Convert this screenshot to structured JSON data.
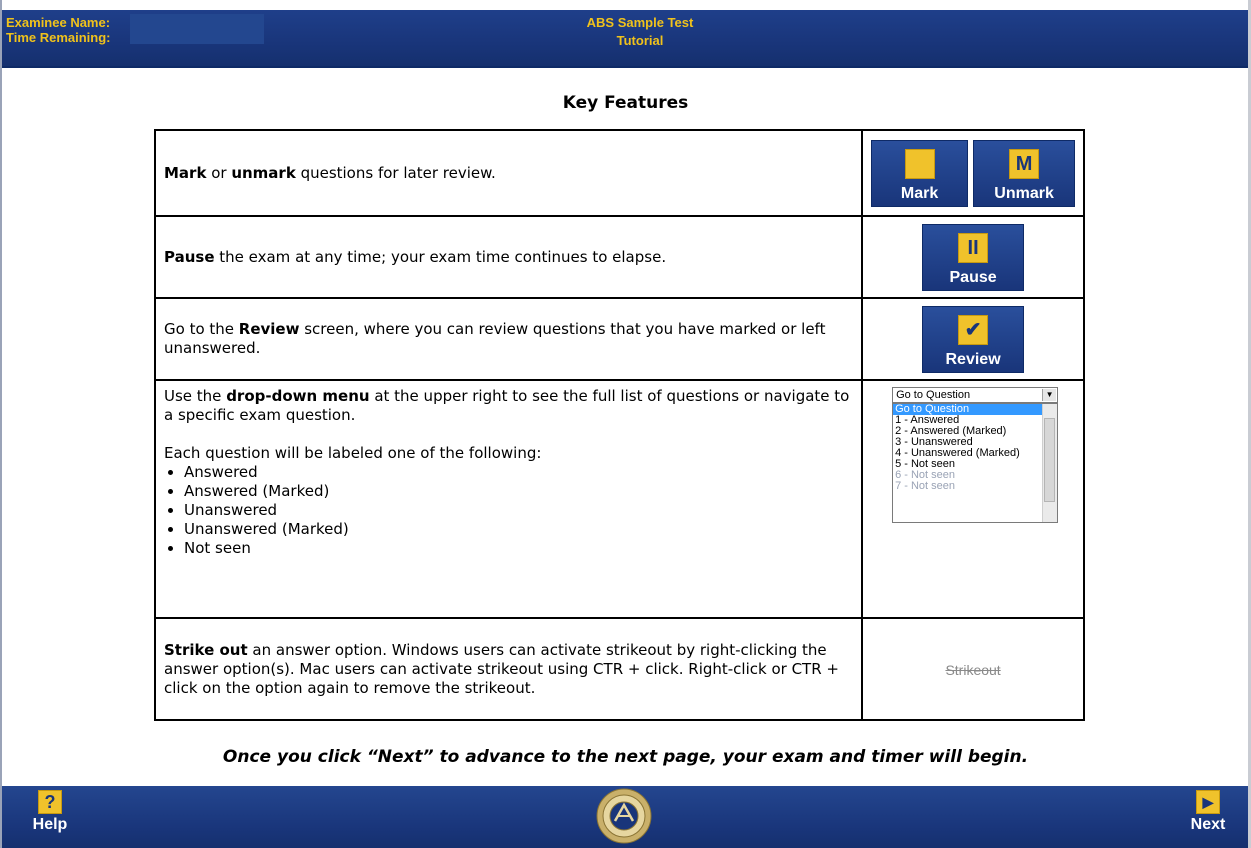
{
  "header": {
    "examinee_label": "Examinee Name:",
    "time_label": "Time Remaining:",
    "test_title": "ABS Sample Test",
    "subtitle": "Tutorial"
  },
  "page_title": "Key Features",
  "rows": {
    "mark": {
      "bold1": "Mark",
      "mid": " or ",
      "bold2": "unmark",
      "rest": " questions for later review.",
      "mark_button": "Mark",
      "unmark_button": "Unmark",
      "unmark_glyph": "M"
    },
    "pause": {
      "bold": "Pause",
      "rest": " the exam at any time; your exam time continues to elapse.",
      "button": "Pause",
      "glyph": "II"
    },
    "review": {
      "pre": "Go to the ",
      "bold": "Review",
      "rest": " screen, where you can review questions that you have marked or left unanswered.",
      "button": "Review",
      "glyph": "✔"
    },
    "dropdown": {
      "pre": "Use the ",
      "bold": "drop-down menu",
      "rest": " at the upper right to see the full list of questions or navigate to a specific exam question.",
      "labels_intro": "Each question will be labeled one of the following:",
      "labels": [
        "Answered",
        "Answered (Marked)",
        "Unanswered",
        "Unanswered (Marked)",
        "Not seen"
      ],
      "select_value": "Go to Question",
      "options": [
        "Go to Question",
        "1 - Answered",
        "2 - Answered (Marked)",
        "3 - Unanswered",
        "4 - Unanswered (Marked)",
        "5 - Not seen",
        "6 - Not seen",
        "7 - Not seen"
      ]
    },
    "strike": {
      "bold": "Strike out",
      "rest": " an answer option. Windows users can activate strikeout by right-clicking the answer option(s). Mac users can activate strikeout using CTR + click. Right-click or CTR + click on the option again to remove the strikeout.",
      "sample": "Strikeout"
    }
  },
  "notice": "Once you click “Next” to advance to the next page, your exam and timer will begin.",
  "footer": {
    "help_label": "Help",
    "help_glyph": "?",
    "next_label": "Next",
    "next_glyph": "▶"
  },
  "colors": {
    "bar_blue": "#19357a",
    "accent_yellow": "#f0c22b"
  }
}
